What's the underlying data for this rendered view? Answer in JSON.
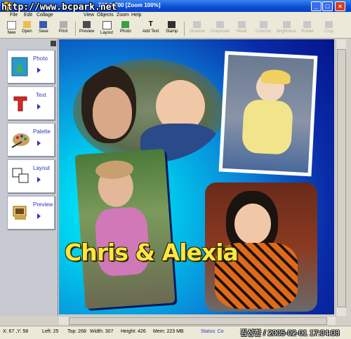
{
  "window": {
    "watermark": "http://www.bcpark.net",
    "title": "700 X 700  [Zoom 100%]"
  },
  "menu": [
    "File",
    "Edit",
    "Collage",
    "View",
    "Objects",
    "Zoom",
    "Help"
  ],
  "toolbar": [
    {
      "label": "New",
      "icon": "new-doc-icon"
    },
    {
      "label": "Open",
      "icon": "folder-open-icon"
    },
    {
      "label": "Save",
      "icon": "floppy-disk-icon"
    },
    {
      "label": "Print",
      "icon": "printer-icon"
    },
    {
      "label": "Preview",
      "icon": "monitor-icon"
    },
    {
      "label": "Layout",
      "icon": "layout-grid-icon"
    },
    {
      "label": "Photo",
      "icon": "photo-icon"
    },
    {
      "label": "Add Text",
      "icon": "text-t-icon"
    },
    {
      "label": "Stamp",
      "icon": "stamp-icon"
    },
    {
      "label": "Shadow",
      "icon": "shadow-icon",
      "disabled": true
    },
    {
      "label": "Grayscale",
      "icon": "grayscale-icon",
      "disabled": true
    },
    {
      "label": "Mask",
      "icon": "mask-icon",
      "disabled": true
    },
    {
      "label": "Colorize",
      "icon": "colorize-icon",
      "disabled": true
    },
    {
      "label": "Brightness",
      "icon": "brightness-icon",
      "disabled": true
    },
    {
      "label": "Rotate",
      "icon": "rotate-icon",
      "disabled": true
    },
    {
      "label": "Crop",
      "icon": "crop-icon",
      "disabled": true
    }
  ],
  "sidebar": [
    {
      "label": "Photo",
      "icon": "photo-frame-icon"
    },
    {
      "label": "Text",
      "icon": "text-t-icon"
    },
    {
      "label": "Palette",
      "icon": "palette-icon"
    },
    {
      "label": "Layout",
      "icon": "layout-frames-icon"
    },
    {
      "label": "Preview",
      "icon": "preview-computer-icon"
    }
  ],
  "canvas": {
    "caption": "Chris & Alexia",
    "colors": {
      "glow": "#00e8ff",
      "deep": "#0a1e9c",
      "caption": "#ffe640"
    }
  },
  "status": {
    "coords": "X: 67 ,Y: 58",
    "left": "Left: 25",
    "top": "Top: 268",
    "width": "Width: 307",
    "height": "Height: 426",
    "mem": "Mem: 223 MB",
    "status": "Status: Co"
  },
  "stamp": "김성한 / 2005-02-01 17:04:03"
}
